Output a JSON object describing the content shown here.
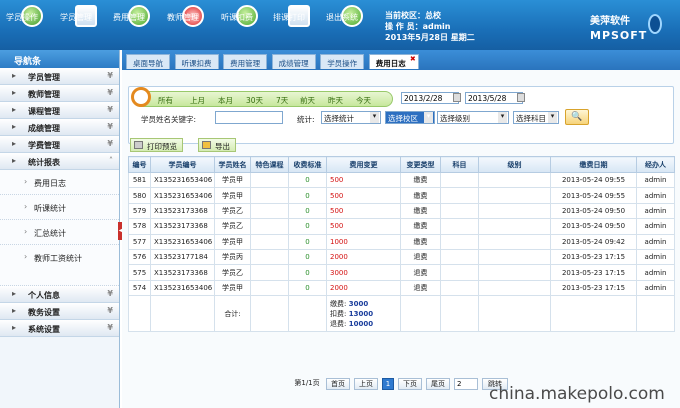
{
  "toolbar": {
    "buttons": [
      {
        "label": "学员操作",
        "icon": "search-icon"
      },
      {
        "label": "学员管理",
        "icon": "student-icon"
      },
      {
        "label": "费用管理",
        "icon": "money-icon"
      },
      {
        "label": "教师管理",
        "icon": "teacher-icon"
      },
      {
        "label": "听课扣费",
        "icon": "globe-icon"
      },
      {
        "label": "排课打印",
        "icon": "print-icon"
      },
      {
        "label": "退出系统",
        "icon": "power-icon"
      }
    ],
    "user": {
      "campus": "当前校区：总校",
      "operator": "操 作 员：admin",
      "date": "2013年5月28日 星期二"
    },
    "brand": {
      "name": "美萍软件",
      "en": "MPSOFT"
    }
  },
  "sidebar": {
    "header": "导航条",
    "groups_top": [
      "学员管理",
      "教师管理",
      "课程管理",
      "成绩管理",
      "学费管理",
      "统计报表"
    ],
    "sub_items": [
      "费用日志",
      "听课统计",
      "汇总统计",
      "教师工资统计"
    ],
    "groups_bottom": [
      "个人信息",
      "教务设置",
      "系统设置"
    ]
  },
  "tabs": [
    "桌面导航",
    "听课扣费",
    "费用管理",
    "成绩管理",
    "学员操作",
    "费用日志"
  ],
  "filter": {
    "quick": [
      "所有",
      "上月",
      "本月",
      "30天",
      "7天",
      "前天",
      "昨天",
      "今天"
    ],
    "date_from": "2013/2/28",
    "date_to": "2013/5/28",
    "keyword_label": "学员姓名关键字:",
    "stat_label": "统计:",
    "stat_select": "选择统计",
    "campus_select": "选择校区",
    "level_select": "选择级别",
    "subject_select": "选择科目"
  },
  "actions": {
    "print": "打印预览",
    "export": "导出"
  },
  "table": {
    "columns": [
      "编号",
      "学员编号",
      "学员姓名",
      "特色课程",
      "收费标准",
      "费用变更",
      "变更类型",
      "科目",
      "级别",
      "缴费日期",
      "经办人"
    ],
    "rows": [
      [
        "581",
        "X135231653406",
        "学员甲",
        "",
        "0",
        "500",
        "缴费",
        "",
        "",
        "2013-05-24 09:55",
        "admin"
      ],
      [
        "580",
        "X135231653406",
        "学员甲",
        "",
        "0",
        "500",
        "缴费",
        "",
        "",
        "2013-05-24 09:55",
        "admin"
      ],
      [
        "579",
        "X13523173368",
        "学员乙",
        "",
        "0",
        "500",
        "缴费",
        "",
        "",
        "2013-05-24 09:50",
        "admin"
      ],
      [
        "578",
        "X13523173368",
        "学员乙",
        "",
        "0",
        "500",
        "缴费",
        "",
        "",
        "2013-05-24 09:50",
        "admin"
      ],
      [
        "577",
        "X135231653406",
        "学员甲",
        "",
        "0",
        "1000",
        "缴费",
        "",
        "",
        "2013-05-24 09:42",
        "admin"
      ],
      [
        "576",
        "X13523177184",
        "学员丙",
        "",
        "0",
        "2000",
        "退费",
        "",
        "",
        "2013-05-23 17:15",
        "admin"
      ],
      [
        "575",
        "X13523173368",
        "学员乙",
        "",
        "0",
        "3000",
        "退费",
        "",
        "",
        "2013-05-23 17:15",
        "admin"
      ],
      [
        "574",
        "X135231653406",
        "学员甲",
        "",
        "0",
        "2000",
        "退费",
        "",
        "",
        "2013-05-23 17:15",
        "admin"
      ]
    ],
    "total": {
      "label": "合计:",
      "fee_label": "缴费:",
      "fee_value": "3000",
      "deduct_label": "扣费:",
      "deduct_value": "13000",
      "refund_label": "退费:",
      "refund_value": "10000"
    }
  },
  "pager": {
    "info": "第1/1页",
    "first": "首页",
    "prev": "上页",
    "current": "1",
    "next": "下页",
    "last": "尾页",
    "goto_value": "2",
    "jump": "跳转"
  },
  "watermark": "china.makepolo.com"
}
